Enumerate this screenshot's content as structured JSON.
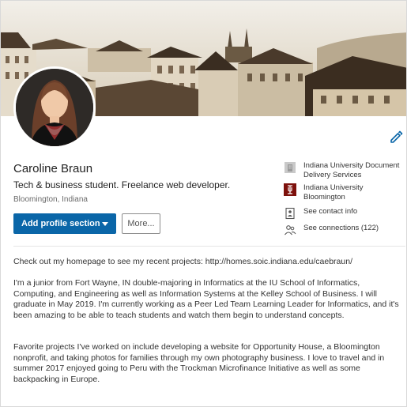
{
  "profile": {
    "name": "Caroline Braun",
    "headline": "Tech & business student. Freelance web developer.",
    "location": "Bloomington, Indiana"
  },
  "actions": {
    "add_section": "Add profile section",
    "more": "More..."
  },
  "side": {
    "employer": "Indiana University Document Delivery Services",
    "school": "Indiana University Bloomington",
    "contact": "See contact info",
    "connections": "See connections (122)"
  },
  "summary": {
    "p1": "Check out my homepage to see my recent projects: http://homes.soic.indiana.edu/caebraun/",
    "p2": "I'm a junior from Fort Wayne, IN double-majoring in Informatics at the IU School of Informatics, Computing, and Engineering as well as Information Systems at the Kelley School of Business. I will graduate in May 2019. I'm currently working as a Peer Led Team Learning Leader for Informatics, and it's been amazing to be able to teach students and watch them begin to understand concepts.",
    "p3": "Favorite projects I've worked on include developing a website for Opportunity House, a Bloomington nonprofit, and taking photos for families through my own photography business. I love to travel and in summer 2017 enjoyed going to Peru with the Trockman Microfinance Initiative as well as some backpacking in Europe."
  },
  "icons": {
    "edit": "pencil-icon",
    "employer": "building-icon",
    "school": "iu-logo-icon",
    "contact": "contact-card-icon",
    "connections": "people-icon"
  },
  "colors": {
    "primary": "#0a66a8",
    "iu_crimson": "#7d110c",
    "banner_tone": "#d9c8a8"
  }
}
